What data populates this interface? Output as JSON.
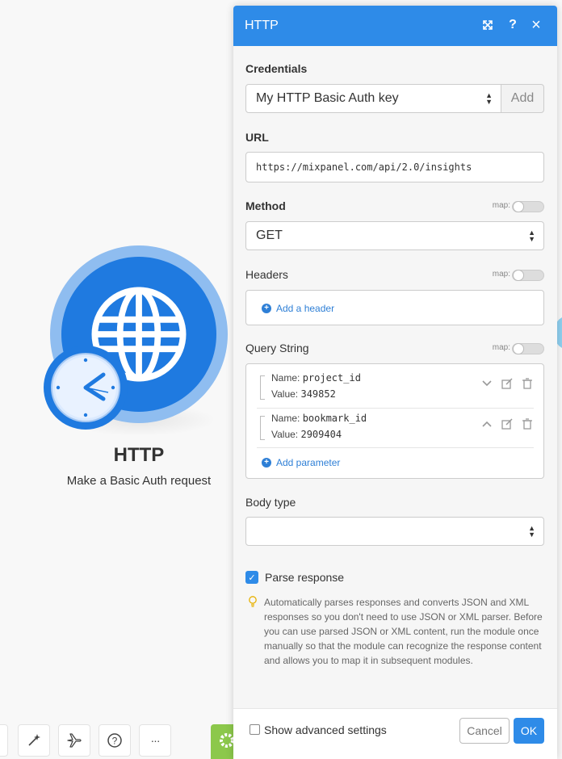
{
  "module": {
    "title": "HTTP",
    "subtitle": "Make a Basic Auth request"
  },
  "toolbar": {
    "buttons": [
      {
        "icon": "magic-wand-icon"
      },
      {
        "icon": "airplane-icon"
      },
      {
        "icon": "help-icon",
        "glyph": "?"
      },
      {
        "icon": "more-icon",
        "glyph": "···"
      }
    ],
    "colors": [
      "#8cc84b",
      "#a97fd8",
      "#e07050",
      "#c0305a",
      "#2e7fd6",
      "#2ea8e0"
    ]
  },
  "panel": {
    "title": "HTTP",
    "header_icons": {
      "expand": "⤡",
      "help": "?",
      "close": "×"
    },
    "credentials": {
      "label": "Credentials",
      "selected": "My HTTP Basic Auth key",
      "add_label": "Add"
    },
    "url": {
      "label": "URL",
      "value": "https://mixpanel.com/api/2.0/insights"
    },
    "method": {
      "label": "Method",
      "map_label": "map:",
      "selected": "GET"
    },
    "headers": {
      "label": "Headers",
      "map_label": "map:",
      "add_label": "Add a header"
    },
    "query_string": {
      "label": "Query String",
      "map_label": "map:",
      "name_label": "Name:",
      "value_label": "Value:",
      "params": [
        {
          "name": "project_id",
          "value": "349852"
        },
        {
          "name": "bookmark_id",
          "value": "2909404"
        }
      ],
      "add_label": "Add parameter"
    },
    "body_type": {
      "label": "Body type",
      "selected": ""
    },
    "parse_response": {
      "label": "Parse response",
      "checked": true,
      "hint": "Automatically parses responses and converts JSON and XML responses so you don't need to use JSON or XML parser. Before you can use parsed JSON or XML content, run the module once manually so that the module can recognize the response content and allows you to map it in subsequent modules."
    },
    "footer": {
      "advanced_label": "Show advanced settings",
      "cancel_label": "Cancel",
      "ok_label": "OK"
    }
  },
  "colors": {
    "accent": "#2e8be8",
    "module_blue": "#1f7ae0"
  }
}
